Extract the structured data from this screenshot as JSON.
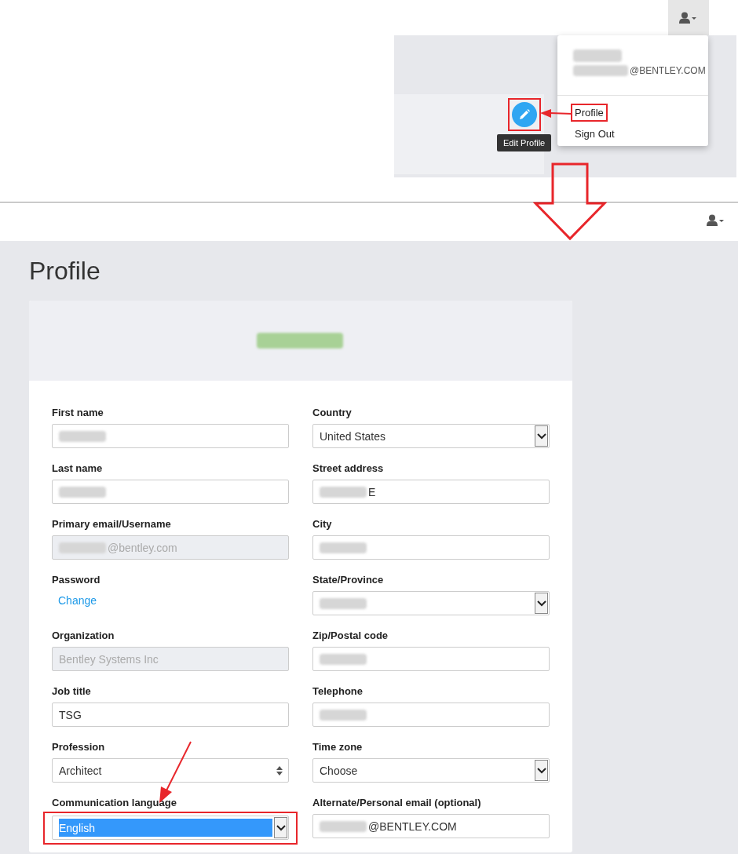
{
  "top_shot": {
    "edit_button": {
      "tooltip": "Edit Profile",
      "highlighted": true
    },
    "menu": {
      "name_redacted": true,
      "email": "@BENTLEY.COM",
      "email_redacted": true,
      "items": [
        {
          "label": "Profile",
          "highlighted": true
        },
        {
          "label": "Sign Out",
          "highlighted": false
        }
      ]
    }
  },
  "profile_page": {
    "title": "Profile",
    "name_redacted": true,
    "fields": [
      {
        "label": "First name",
        "kind": "text",
        "redacted": true,
        "disabled": false
      },
      {
        "label": "Country",
        "kind": "select",
        "value": "United States",
        "disabled": false
      },
      {
        "label": "Last name",
        "kind": "text",
        "redacted": true,
        "disabled": false
      },
      {
        "label": "Street address",
        "kind": "text",
        "value": "E",
        "redacted": true,
        "disabled": false
      },
      {
        "label": "Primary email/Username",
        "kind": "text",
        "value": "@bentley.com",
        "redacted": true,
        "disabled": true
      },
      {
        "label": "City",
        "kind": "text",
        "redacted": true,
        "disabled": false
      },
      {
        "label": "Password",
        "kind": "link",
        "value": "Change"
      },
      {
        "label": "State/Province",
        "kind": "select",
        "redacted": true,
        "disabled": false
      },
      {
        "label": "Organization",
        "kind": "text",
        "value": "Bentley Systems Inc",
        "disabled": true
      },
      {
        "label": "Zip/Postal code",
        "kind": "text",
        "redacted": true,
        "disabled": false
      },
      {
        "label": "Job title",
        "kind": "text",
        "value": "TSG",
        "disabled": false
      },
      {
        "label": "Telephone",
        "kind": "text",
        "redacted": true,
        "disabled": false
      },
      {
        "label": "Profession",
        "kind": "spin",
        "value": "Architect",
        "disabled": false
      },
      {
        "label": "Time zone",
        "kind": "select",
        "value": "Choose",
        "disabled": false
      },
      {
        "label": "Communication language",
        "kind": "select",
        "value": "English",
        "selected": true,
        "highlighted": true,
        "disabled": false
      },
      {
        "label": "Alternate/Personal email (optional)",
        "kind": "text",
        "value": "@BENTLEY.COM",
        "redacted": true,
        "disabled": false
      }
    ]
  }
}
